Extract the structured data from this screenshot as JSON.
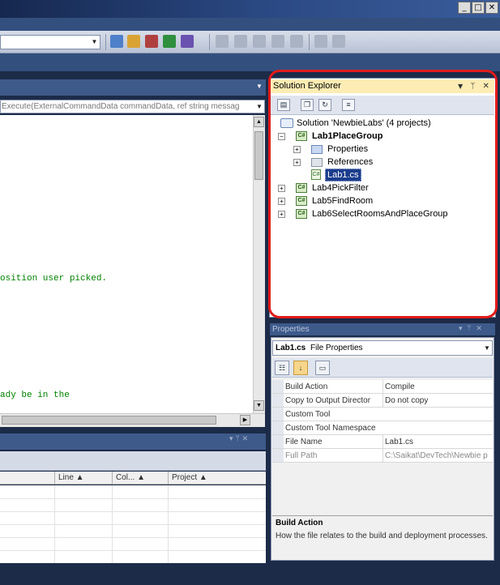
{
  "window": {
    "buttons": {
      "minimize": "_",
      "maximize": "□",
      "close": "✕"
    }
  },
  "toolbar": {
    "config_value": "",
    "icons": [
      "find-in-files-icon",
      "solution-explorer-icon",
      "properties-window-icon",
      "object-browser-icon",
      "toolbox-icon",
      "start-page-icon",
      "indent-icon",
      "outdent-icon",
      "comment-icon",
      "uncomment-icon",
      "bookmark-icon"
    ]
  },
  "editor": {
    "member_combo": "Execute(ExternalCommandData commandData, ref string messag",
    "lines": [
      "osition user picked.",
      "ady be in the"
    ]
  },
  "error_list": {
    "columns": [
      "Line",
      "Col...",
      "Project"
    ]
  },
  "solution_explorer": {
    "title": "Solution Explorer",
    "title_buttons": {
      "dropdown": "▼",
      "pin": "ᛘ",
      "close": "✕"
    },
    "solution": "Solution 'NewbieLabs' (4 projects)",
    "projects": [
      {
        "name": "Lab1PlaceGroup",
        "expanded": true,
        "children": [
          "Properties",
          "References",
          "Lab1.cs"
        ]
      },
      {
        "name": "Lab4PickFilter",
        "expanded": false
      },
      {
        "name": "Lab5FindRoom",
        "expanded": false
      },
      {
        "name": "Lab6SelectRoomsAndPlaceGroup",
        "expanded": false
      }
    ],
    "selected_item": "Lab1.cs"
  },
  "properties": {
    "title": "Properties",
    "object": "Lab1.cs",
    "object_type": "File Properties",
    "rows": [
      {
        "name": "Build Action",
        "value": "Compile",
        "dim": false
      },
      {
        "name": "Copy to Output Director",
        "value": "Do not copy",
        "dim": false
      },
      {
        "name": "Custom Tool",
        "value": "",
        "dim": false
      },
      {
        "name": "Custom Tool Namespace",
        "value": "",
        "dim": false
      },
      {
        "name": "File Name",
        "value": "Lab1.cs",
        "dim": false
      },
      {
        "name": "Full Path",
        "value": "C:\\Saikat\\DevTech\\Newbie p",
        "dim": true
      }
    ],
    "description_title": "Build Action",
    "description_text": "How the file relates to the build and deployment processes."
  },
  "colors": {
    "background": "#1c2b48",
    "highlight_border": "#e11b1b",
    "selected_item": "#1b3c8c",
    "active_title": "#fdedb4",
    "code_comment": "#008000"
  }
}
